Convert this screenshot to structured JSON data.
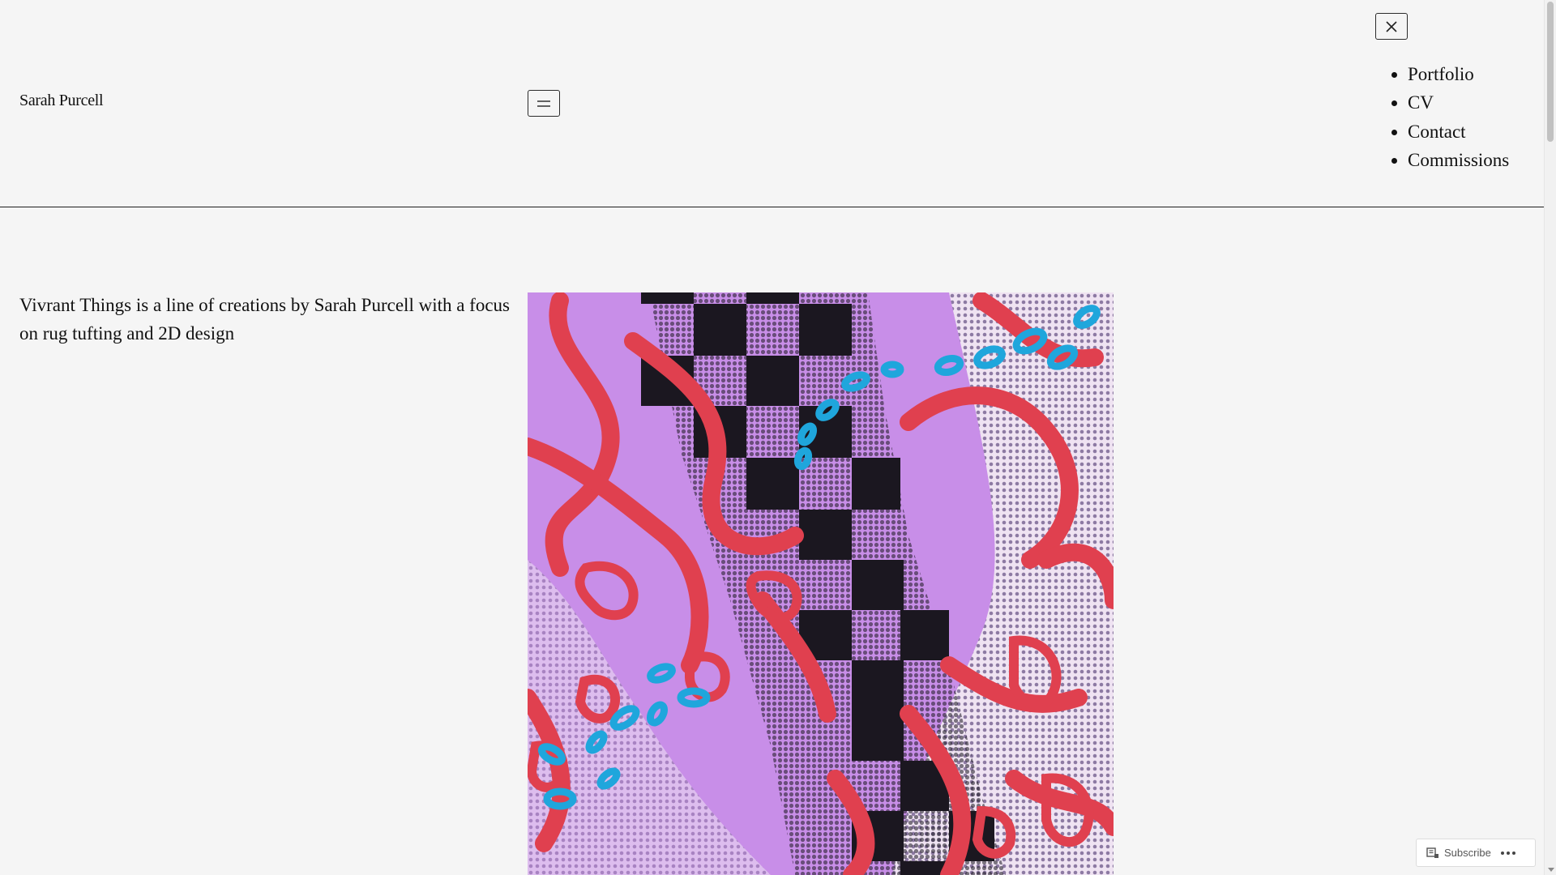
{
  "site": {
    "title": "Sarah Purcell"
  },
  "nav": {
    "items": [
      {
        "label": "Portfolio"
      },
      {
        "label": "CV"
      },
      {
        "label": "Contact"
      },
      {
        "label": "Commissions"
      }
    ]
  },
  "icons": {
    "menu_open": "hamburger-icon",
    "menu_close": "close-icon",
    "subscribe": "reader-icon",
    "more": "ellipsis-icon"
  },
  "main": {
    "intro": "Vivrant Things is a line of creations by Sarah Purcell with a focus on rug tufting and 2D design"
  },
  "artwork": {
    "palette": {
      "background": "#c88ee8",
      "squiggle": "#e0404f",
      "accent": "#1fa6dc",
      "checker": "#1b1720",
      "light": "#efe3f2"
    }
  },
  "footer_bar": {
    "subscribe_label": "Subscribe"
  }
}
